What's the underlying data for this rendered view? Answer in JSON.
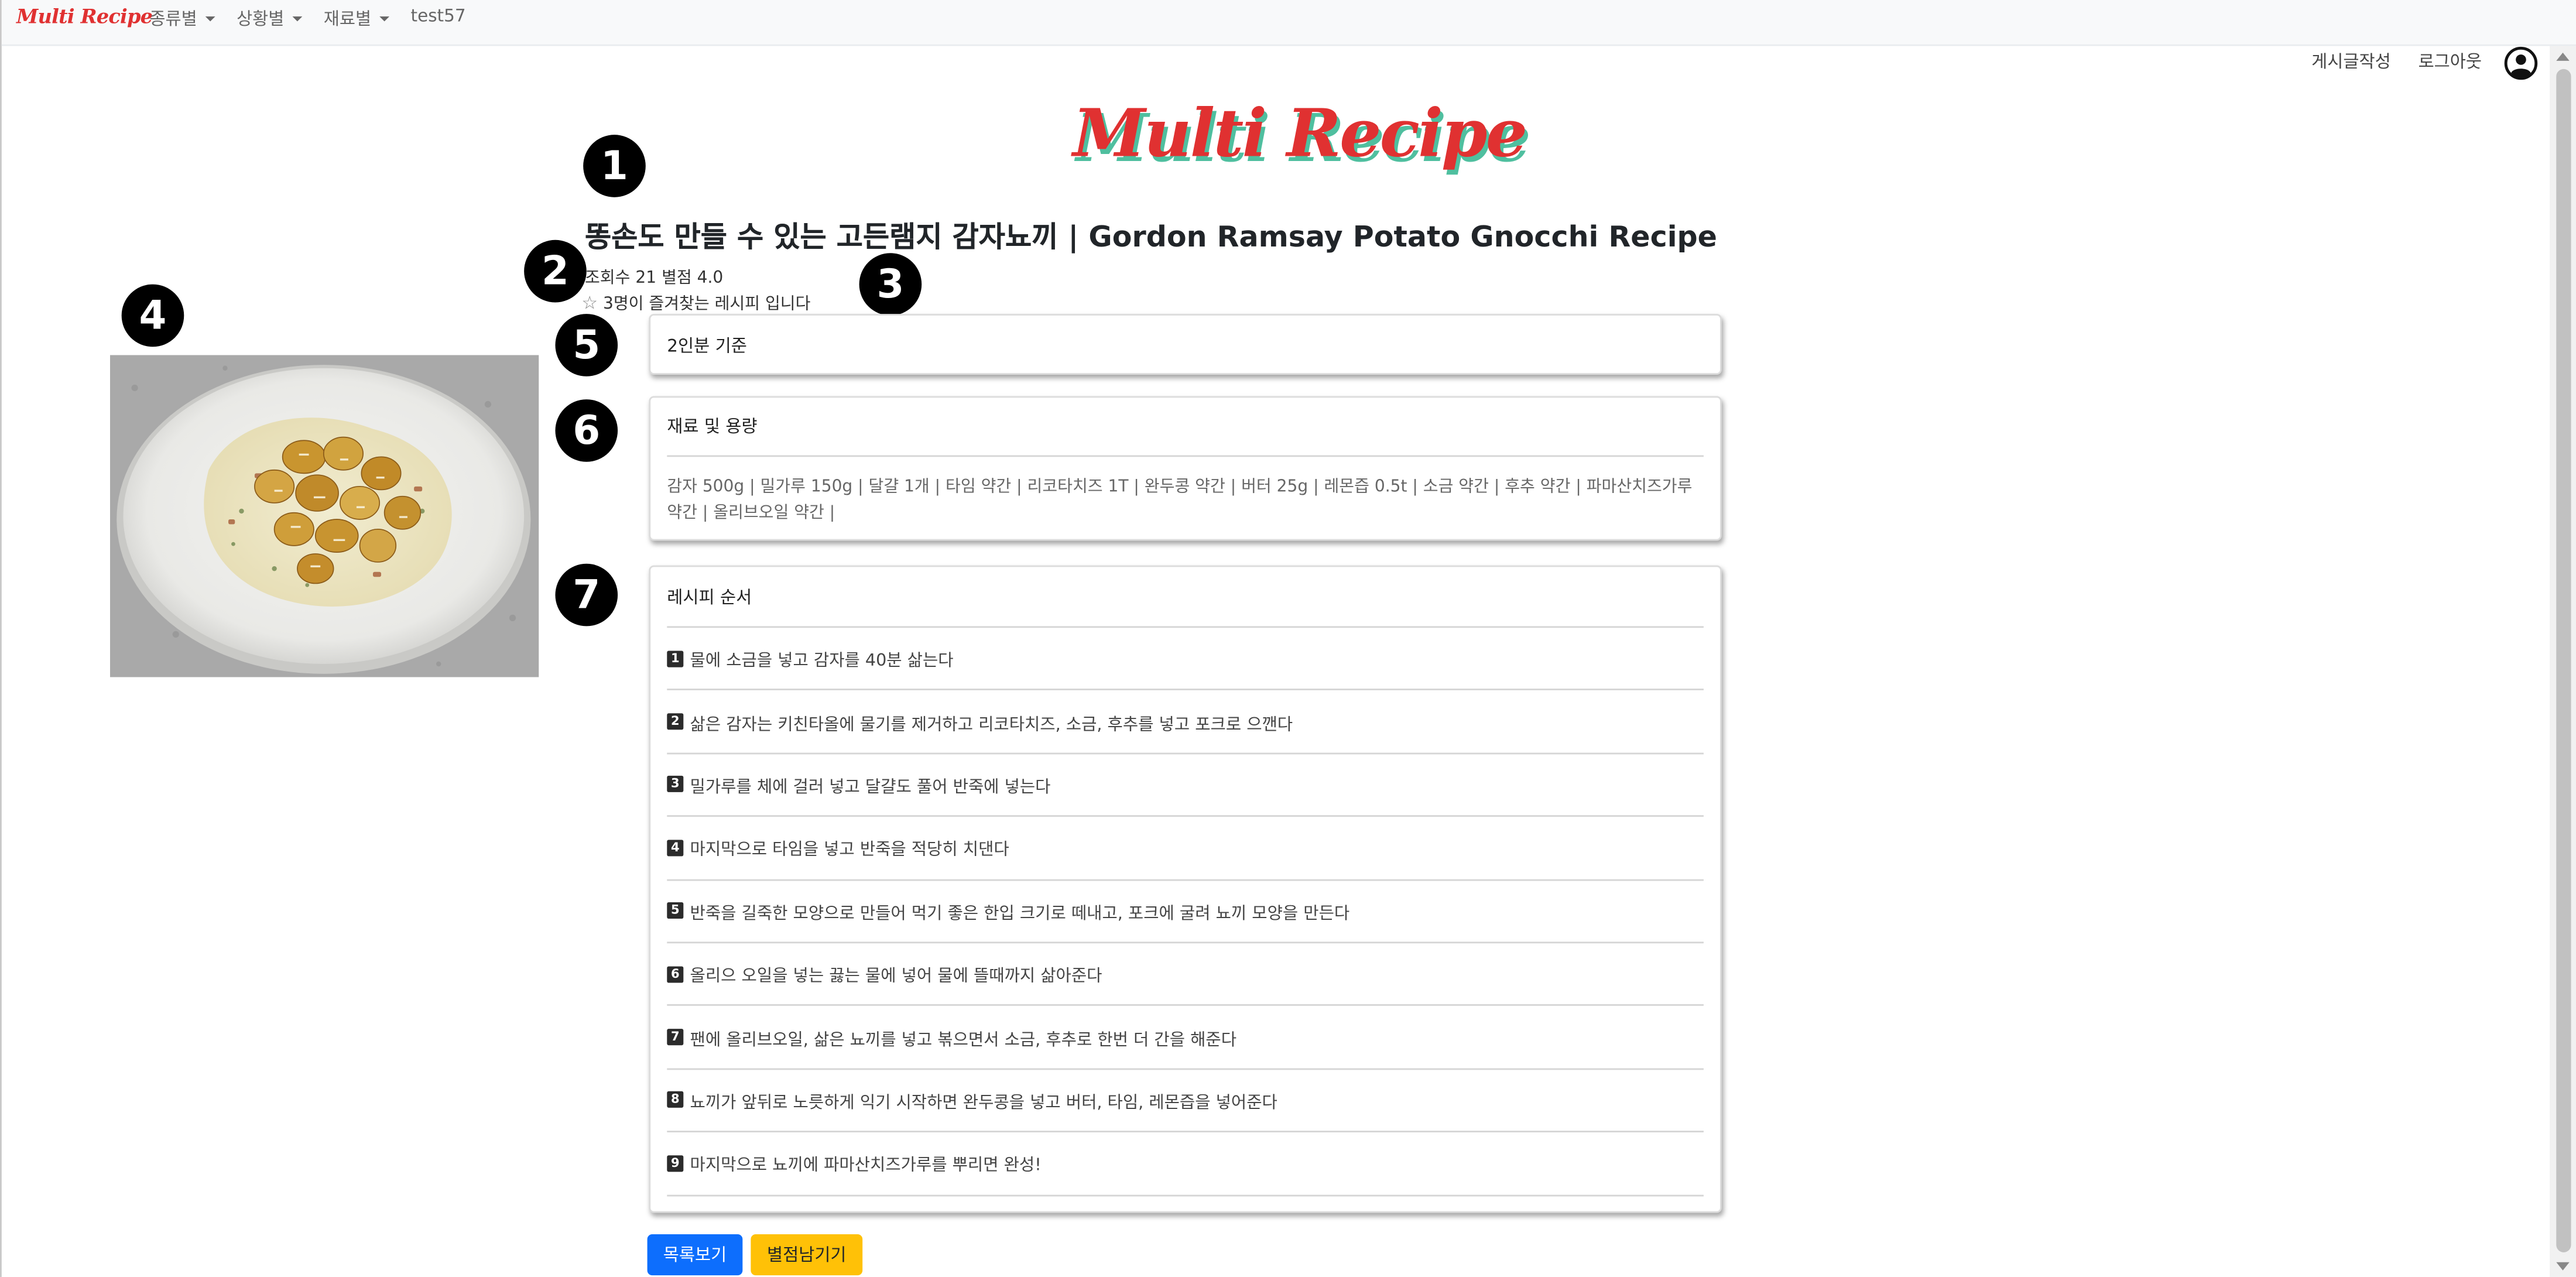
{
  "nav": {
    "brand": "Multi Recipe",
    "menus": [
      "종류별",
      "상황별",
      "재료별"
    ],
    "username": "test57",
    "write_post": "게시글작성",
    "logout": "로그아웃",
    "user_icon": "user-circle-icon"
  },
  "logo": "Multi Recipe",
  "markers": [
    "1",
    "2",
    "3",
    "4",
    "5",
    "6",
    "7"
  ],
  "recipe": {
    "title": "똥손도 만들 수 있는 고든램지 감자뇨끼 | Gordon Ramsay Potato Gnocchi Recipe",
    "views_label": "조회수",
    "views": "21",
    "rating_label": "별점",
    "rating": "4.0",
    "favorite_text": "3명이 즐겨찾는 레시피 입니다",
    "servings": "2인분 기준",
    "ingredients_header": "재료 및 용량",
    "ingredients": "감자 500g | 밀가루 150g | 달걀 1개 | 타임 약간 | 리코타치즈 1T | 완두콩 약간 | 버터 25g | 레몬즙 0.5t | 소금 약간 | 후추 약간 | 파마산치즈가루 약간 | 올리브오일 약간 |",
    "steps_header": "레시피 순서",
    "steps": [
      {
        "num": "1",
        "text": "물에 소금을 넣고 감자를 40분 삶는다"
      },
      {
        "num": "2",
        "text": "삶은 감자는 키친타올에 물기를 제거하고 리코타치즈, 소금, 후추를 넣고 포크로 으깬다"
      },
      {
        "num": "3",
        "text": "밀가루를 체에 걸러 넣고 달걀도 풀어 반죽에 넣는다"
      },
      {
        "num": "4",
        "text": "마지막으로 타임을 넣고 반죽을 적당히 치댄다"
      },
      {
        "num": "5",
        "text": "반죽을 길죽한 모양으로 만들어 먹기 좋은 한입 크기로 떼내고, 포크에 굴려 뇨끼 모양을 만든다"
      },
      {
        "num": "6",
        "text": "올리으 오일을 넣는 끓는 물에 넣어 물에 뜰때까지 삶아준다"
      },
      {
        "num": "7",
        "text": "팬에 올리브오일, 삶은 뇨끼를 넣고 볶으면서 소금, 후추로 한번 더 간을 해준다"
      },
      {
        "num": "8",
        "text": "뇨끼가 앞뒤로 노릇하게 익기 시작하면 완두콩을 넣고 버터, 타임, 레몬즙을 넣어준다"
      },
      {
        "num": "9",
        "text": "마지막으로 뇨끼에 파마산치즈가루를 뿌리면 완성!"
      }
    ]
  },
  "buttons": {
    "list": "목록보기",
    "rate": "별점남기기"
  },
  "colors": {
    "brand_red": "#e03131",
    "primary": "#0d6efd",
    "warning": "#ffc107"
  }
}
